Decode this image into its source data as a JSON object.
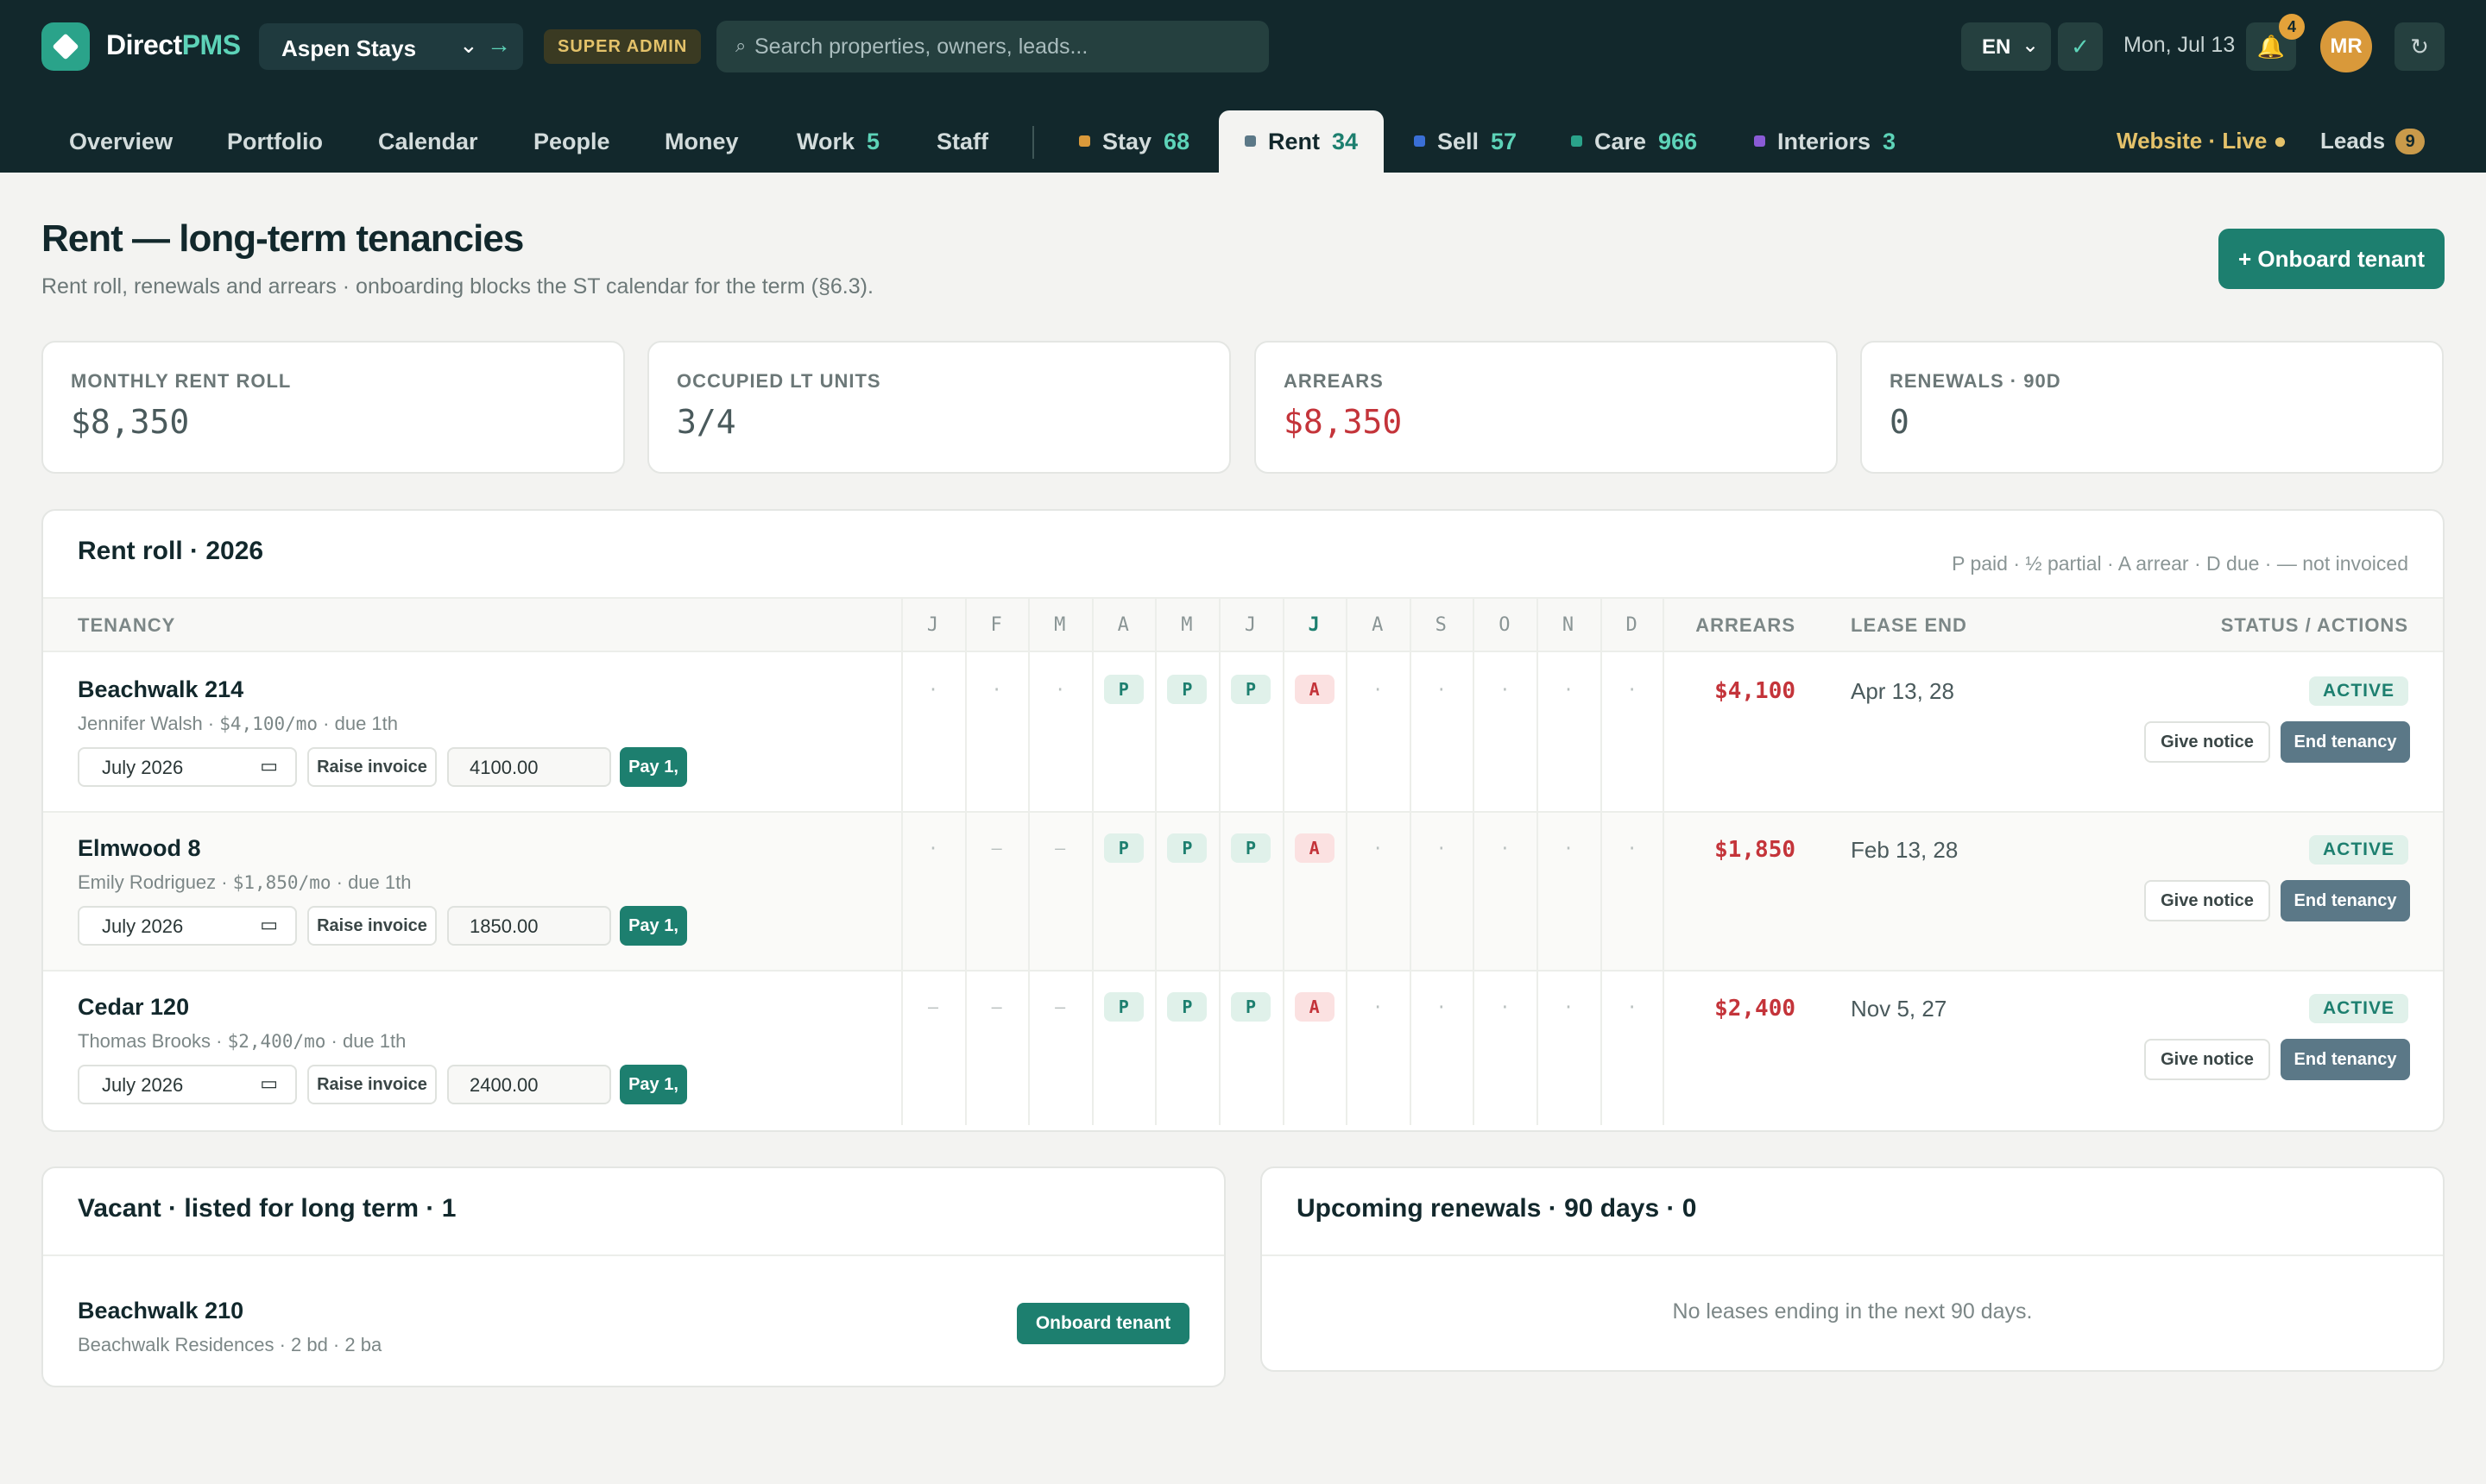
{
  "brand": {
    "name_part1": "Direct",
    "name_part2": "PMS"
  },
  "header": {
    "property_selector": "Aspen Stays",
    "role_badge": "SUPER ADMIN",
    "search_placeholder": "Search properties, owners, leads...",
    "language": "EN",
    "date": "Mon, Jul 13",
    "notification_count": "4",
    "avatar_initials": "MR"
  },
  "nav": {
    "tabs": [
      {
        "label": "Overview",
        "count": ""
      },
      {
        "label": "Portfolio",
        "count": ""
      },
      {
        "label": "Calendar",
        "count": ""
      },
      {
        "label": "People",
        "count": ""
      },
      {
        "label": "Money",
        "count": ""
      },
      {
        "label": "Work",
        "count": "5"
      },
      {
        "label": "Staff",
        "count": ""
      },
      {
        "label": "Stay",
        "count": "68",
        "dot_color": "#d9993a"
      },
      {
        "label": "Rent",
        "count": "34",
        "dot_color": "#5b7887"
      },
      {
        "label": "Sell",
        "count": "57",
        "dot_color": "#3a6fd6"
      },
      {
        "label": "Care",
        "count": "966",
        "dot_color": "#2aa38a"
      },
      {
        "label": "Interiors",
        "count": "3",
        "dot_color": "#8a5bd6"
      }
    ],
    "website_status": "Website · Live ●",
    "leads_label": "Leads",
    "leads_count": "9"
  },
  "page": {
    "title": "Rent — long-term tenancies",
    "subtitle": "Rent roll, renewals and arrears · onboarding blocks the ST calendar for the term (§6.3).",
    "primary_action": "+ Onboard tenant"
  },
  "kpis": [
    {
      "label": "MONTHLY RENT ROLL",
      "value": "$8,350"
    },
    {
      "label": "OCCUPIED LT UNITS",
      "value": "3/4"
    },
    {
      "label": "ARREARS",
      "value": "$8,350"
    },
    {
      "label": "RENEWALS · 90D",
      "value": "0"
    }
  ],
  "rent_roll": {
    "title": "Rent roll · 2026",
    "legend": "P paid · ½ partial · A arrear · D due · — not invoiced",
    "columns": {
      "tenancy": "TENANCY",
      "months": [
        "J",
        "F",
        "M",
        "A",
        "M",
        "J",
        "J",
        "A",
        "S",
        "O",
        "N",
        "D"
      ],
      "arrears": "ARREARS",
      "lease_end": "LEASE END",
      "status": "STATUS / ACTIONS"
    },
    "rows": [
      {
        "name": "Beachwalk 214",
        "tenant": "Jennifer Walsh · ",
        "rent": "$4,100/mo",
        "due": " · due 1th",
        "month_input": "July  2026",
        "raise_label": "Raise invoice",
        "amount": "4100.00",
        "pay_label": "Pay 1,",
        "months": [
          "·",
          "·",
          "·",
          "P",
          "P",
          "P",
          "A",
          "·",
          "·",
          "·",
          "·",
          "·"
        ],
        "arrears": "$4,100",
        "lease_end": "Apr 13, 28",
        "status": "ACTIVE",
        "notice_label": "Give notice",
        "end_label": "End tenancy"
      },
      {
        "name": "Elmwood 8",
        "tenant": "Emily Rodriguez · ",
        "rent": "$1,850/mo",
        "due": " · due 1th",
        "month_input": "July  2026",
        "raise_label": "Raise invoice",
        "amount": "1850.00",
        "pay_label": "Pay 1,",
        "months": [
          "·",
          "—",
          "—",
          "P",
          "P",
          "P",
          "A",
          "·",
          "·",
          "·",
          "·",
          "·"
        ],
        "arrears": "$1,850",
        "lease_end": "Feb 13, 28",
        "status": "ACTIVE",
        "notice_label": "Give notice",
        "end_label": "End tenancy"
      },
      {
        "name": "Cedar 120",
        "tenant": "Thomas Brooks · ",
        "rent": "$2,400/mo",
        "due": " · due 1th",
        "month_input": "July  2026",
        "raise_label": "Raise invoice",
        "amount": "2400.00",
        "pay_label": "Pay 1,",
        "months": [
          "—",
          "—",
          "—",
          "P",
          "P",
          "P",
          "A",
          "·",
          "·",
          "·",
          "·",
          "·"
        ],
        "arrears": "$2,400",
        "lease_end": "Nov 5, 27",
        "status": "ACTIVE",
        "notice_label": "Give notice",
        "end_label": "End tenancy"
      }
    ]
  },
  "vacant": {
    "title": "Vacant · listed for long term · 1",
    "items": [
      {
        "name": "Beachwalk 210",
        "meta": "Beachwalk Residences · 2 bd · 2 ba",
        "action": "Onboard tenant"
      }
    ]
  },
  "renewals": {
    "title": "Upcoming renewals · 90 days · 0",
    "empty": "No leases ending in the next 90 days."
  },
  "colors": {
    "header_bg": "#12282c",
    "accent": "#1d7f6f",
    "arrear_red": "#c4343a",
    "gold": "#e4c26a"
  },
  "icons": {
    "logo": "diamond-logo-icon",
    "search": "search-icon",
    "check": "check-icon",
    "bell": "bell-icon",
    "refresh": "refresh-icon",
    "calendar": "calendar-icon"
  }
}
